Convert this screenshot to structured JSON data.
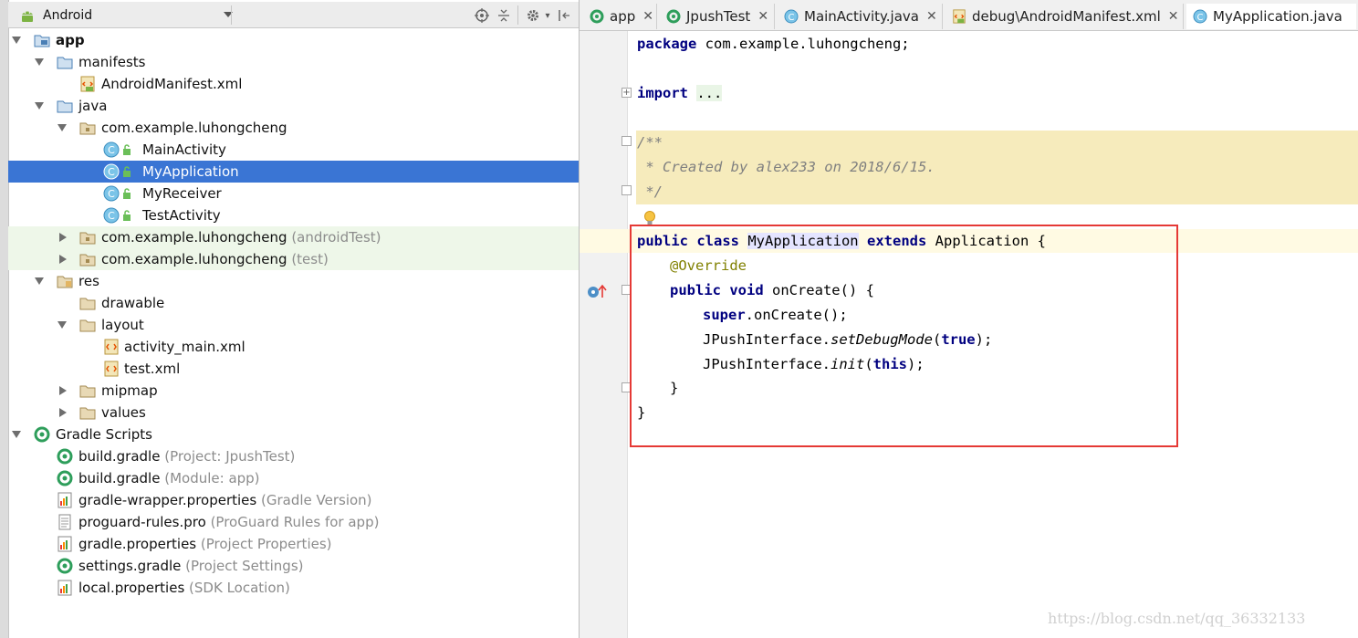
{
  "project_panel": {
    "view_mode": "Android",
    "header_icons": [
      "target-icon",
      "collapse-all-icon",
      "gear-icon",
      "hide-panel-icon"
    ]
  },
  "tree": {
    "app": "app",
    "manifests": "manifests",
    "android_manifest": "AndroidManifest.xml",
    "java": "java",
    "pkg_main": "com.example.luhongcheng",
    "main_activity": "MainActivity",
    "my_application": "MyApplication",
    "my_receiver": "MyReceiver",
    "test_activity": "TestActivity",
    "pkg_android_test": "com.example.luhongcheng",
    "pkg_android_test_hint": "(androidTest)",
    "pkg_test": "com.example.luhongcheng",
    "pkg_test_hint": "(test)",
    "res": "res",
    "drawable": "drawable",
    "layout": "layout",
    "activity_main_xml": "activity_main.xml",
    "test_xml": "test.xml",
    "mipmap": "mipmap",
    "values": "values",
    "gradle_scripts": "Gradle Scripts",
    "build_gradle_project": "build.gradle",
    "build_gradle_project_hint": "(Project: JpushTest)",
    "build_gradle_module": "build.gradle",
    "build_gradle_module_hint": "(Module: app)",
    "gradle_wrapper": "gradle-wrapper.properties",
    "gradle_wrapper_hint": "(Gradle Version)",
    "proguard": "proguard-rules.pro",
    "proguard_hint": "(ProGuard Rules for app)",
    "gradle_properties": "gradle.properties",
    "gradle_properties_hint": "(Project Properties)",
    "settings_gradle": "settings.gradle",
    "settings_gradle_hint": "(Project Settings)",
    "local_properties": "local.properties",
    "local_properties_hint": "(SDK Location)"
  },
  "tabs": [
    {
      "label": "app",
      "close": "✕"
    },
    {
      "label": "JpushTest",
      "close": "✕"
    },
    {
      "label": "MainActivity.java",
      "close": "✕"
    },
    {
      "label": "debug\\AndroidManifest.xml",
      "close": "✕"
    },
    {
      "label": "MyApplication.java",
      "close": ""
    }
  ],
  "code": {
    "package_kw": "package",
    "package_name": " com.example.luhongcheng;",
    "import_kw": "import",
    "import_dots": "...",
    "doc1": "/**",
    "doc2": " * Created by alex233 on 2018/6/15.",
    "doc3": " */",
    "class_kw": "public class ",
    "class_name": "MyApplication",
    "extends_kw": " extends ",
    "class_tail": "Application {",
    "override": "@Override",
    "method_kw": "public void ",
    "method_name": "onCreate() {",
    "super_kw": "super",
    "super_tail": ".onCreate();",
    "jpush1_a": "JPushInterface.",
    "jpush1_m": "setDebugMode",
    "jpush1_p1": "(",
    "jpush1_t": "true",
    "jpush1_p2": ");",
    "jpush2_a": "JPushInterface.",
    "jpush2_m": "init",
    "jpush2_p1": "(",
    "jpush2_t": "this",
    "jpush2_p2": ");",
    "close_method": "}",
    "close_class": "}"
  },
  "colors": {
    "selection": "#3a75d4",
    "keyword": "#000080",
    "annotation": "#808000",
    "comment": "#808080",
    "highlight_box": "#e53935",
    "doc_background": "#f6ebbc"
  },
  "watermark": "https://blog.csdn.net/qq_36332133"
}
